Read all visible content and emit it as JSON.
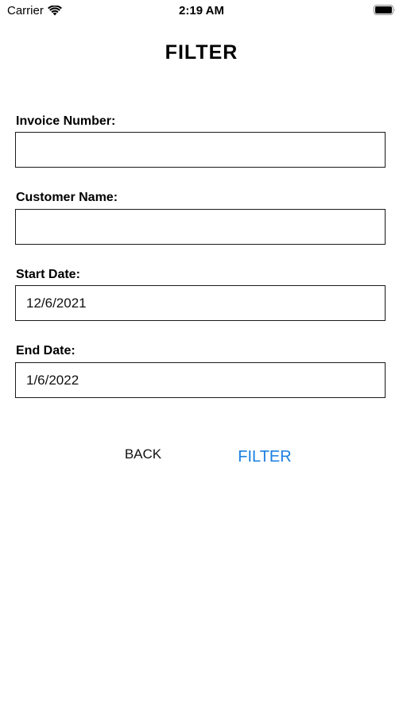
{
  "status_bar": {
    "carrier": "Carrier",
    "time": "2:19 AM",
    "icons": [
      "wifi-icon",
      "battery-icon"
    ]
  },
  "title": "FILTER",
  "form": {
    "invoice_number": {
      "label": "Invoice Number:",
      "value": ""
    },
    "customer_name": {
      "label": "Customer Name:",
      "value": ""
    },
    "start_date": {
      "label": "Start Date:",
      "value": "12/6/2021"
    },
    "end_date": {
      "label": "End Date:",
      "value": "1/6/2022"
    }
  },
  "buttons": {
    "back_label": "BACK",
    "filter_label": "FILTER"
  },
  "colors": {
    "accent": "#1a7fe0",
    "text": "#000000",
    "border": "#1a1a1a",
    "background": "#ffffff"
  }
}
